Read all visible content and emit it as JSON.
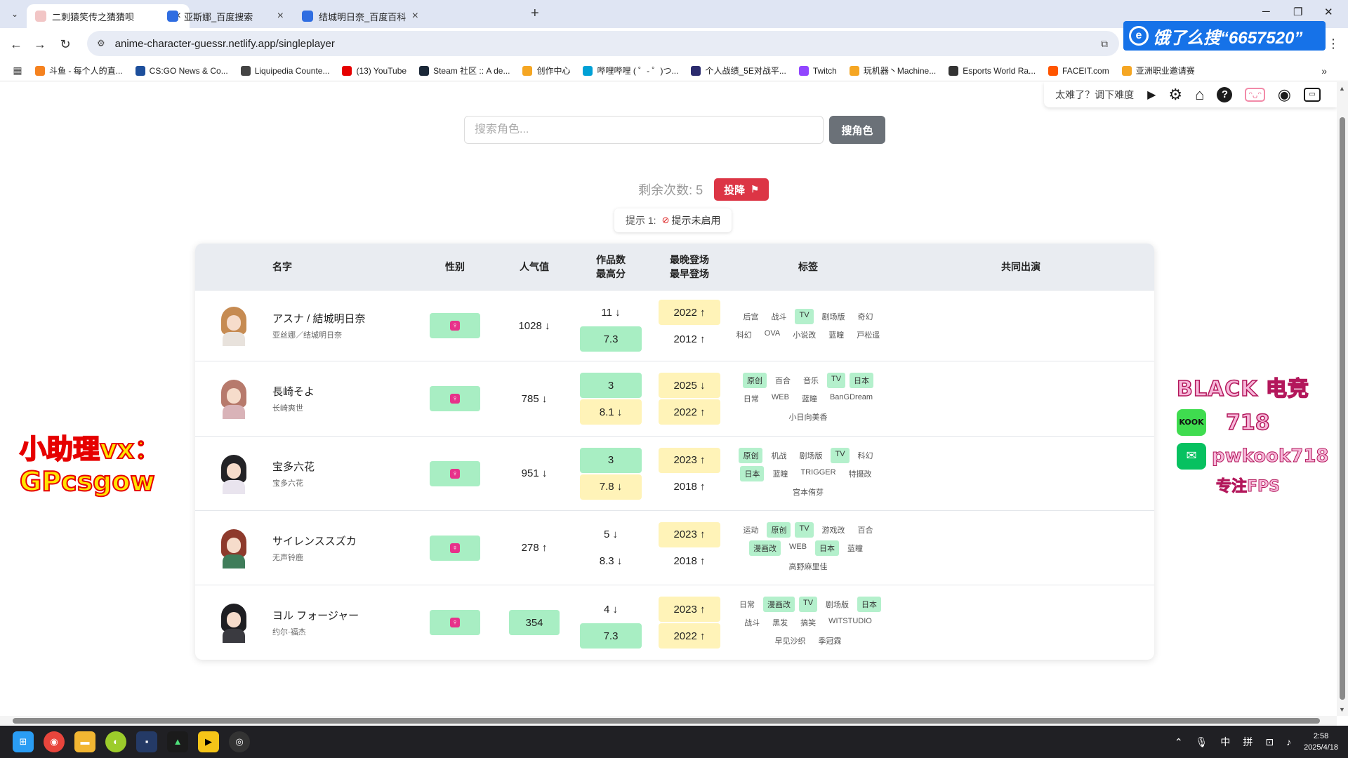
{
  "browser": {
    "tabs": [
      {
        "title": "二刺猿笑传之猜猜呗",
        "fav_color": "#f2c6c6",
        "active": true
      },
      {
        "title": "亚斯娜_百度搜索",
        "fav_color": "#2f6de1",
        "active": false
      },
      {
        "title": "结城明日奈_百度百科",
        "fav_color": "#2f6de1",
        "active": false
      }
    ],
    "url": "anime-character-guessr.netlify.app/singleplayer",
    "promo_text": "饿了么搜“6657520”",
    "bookmarks": [
      {
        "label": "斗鱼 - 每个人的直...",
        "color": "#f58220"
      },
      {
        "label": "CS:GO News & Co...",
        "color": "#1d4f9c"
      },
      {
        "label": "Liquipedia Counte...",
        "color": "#444444"
      },
      {
        "label": "(13) YouTube",
        "color": "#e60000"
      },
      {
        "label": "Steam 社区 :: A de...",
        "color": "#1b2838"
      },
      {
        "label": "创作中心",
        "color": "#f5a623"
      },
      {
        "label": "哔哩哔哩 ( ゜- ゜)つ...",
        "color": "#00a1d6"
      },
      {
        "label": "个人战绩_5E对战平...",
        "color": "#2b2b6e"
      },
      {
        "label": "Twitch",
        "color": "#9146ff"
      },
      {
        "label": "玩机器丶Machine...",
        "color": "#f5a623"
      },
      {
        "label": "Esports World Ra...",
        "color": "#333333"
      },
      {
        "label": "FACEIT.com",
        "color": "#ff5500"
      },
      {
        "label": "亚洲职业邀请赛",
        "color": "#f5a623"
      }
    ]
  },
  "controls": {
    "difficulty_text": "太难了？调下难度"
  },
  "search": {
    "placeholder": "搜索角色...",
    "button_label": "搜角色"
  },
  "status": {
    "remaining": "剩余次数: 5",
    "giveup_label": "投降",
    "hint_label": "提示 1:",
    "hint_value": "提示未启用"
  },
  "table": {
    "headers": {
      "name": "名字",
      "gender": "性别",
      "popularity": "人气值",
      "works_1": "作品数",
      "works_2": "最高分",
      "appear_1": "最晚登场",
      "appear_2": "最早登场",
      "tags": "标签",
      "co_star": "共同出演"
    },
    "rows": [
      {
        "name": "アスナ / 結城明日奈",
        "alt": "亚丝娜／结城明日奈",
        "avatar_hair": "#c68b52",
        "avatar_body": "#e8e2dc",
        "popularity": "1028 ↓",
        "pop_style": "",
        "works": "11 ↓",
        "works_style": "",
        "score": "7.3",
        "score_style": "green",
        "latest": "2022 ↑",
        "latest_style": "yellow",
        "earliest": "2012 ↑",
        "earliest_style": "",
        "tags": [
          {
            "t": "后宫",
            "hit": false
          },
          {
            "t": "战斗",
            "hit": false
          },
          {
            "t": "TV",
            "hit": true
          },
          {
            "t": "剧场版",
            "hit": false
          },
          {
            "t": "奇幻",
            "hit": false
          },
          {
            "t": "科幻",
            "hit": false
          },
          {
            "t": "OVA",
            "hit": false
          },
          {
            "t": "小说改",
            "hit": false
          },
          {
            "t": "蓝瞳",
            "hit": false
          },
          {
            "t": "戸松遥",
            "hit": false
          }
        ]
      },
      {
        "name": "長崎そよ",
        "alt": "长崎爽世",
        "avatar_hair": "#b77a6c",
        "avatar_body": "#d9b3b8",
        "popularity": "785 ↓",
        "pop_style": "",
        "works": "3",
        "works_style": "green",
        "score": "8.1 ↓",
        "score_style": "yellow",
        "latest": "2025 ↓",
        "latest_style": "yellow",
        "earliest": "2022 ↑",
        "earliest_style": "yellow",
        "tags": [
          {
            "t": "原创",
            "hit": true
          },
          {
            "t": "百合",
            "hit": false
          },
          {
            "t": "音乐",
            "hit": false
          },
          {
            "t": "TV",
            "hit": true
          },
          {
            "t": "日本",
            "hit": true
          },
          {
            "t": "日常",
            "hit": false
          },
          {
            "t": "WEB",
            "hit": false
          },
          {
            "t": "蓝瞳",
            "hit": false
          },
          {
            "t": "BanGDream",
            "hit": false
          },
          {
            "t": "小日向美香",
            "hit": false
          }
        ]
      },
      {
        "name": "宝多六花",
        "alt": "宝多六花",
        "avatar_hair": "#232326",
        "avatar_body": "#e9e4ee",
        "popularity": "951 ↓",
        "pop_style": "",
        "works": "3",
        "works_style": "green",
        "score": "7.8 ↓",
        "score_style": "yellow",
        "latest": "2023 ↑",
        "latest_style": "yellow",
        "earliest": "2018 ↑",
        "earliest_style": "",
        "tags": [
          {
            "t": "原创",
            "hit": true
          },
          {
            "t": "机战",
            "hit": false
          },
          {
            "t": "剧场版",
            "hit": false
          },
          {
            "t": "TV",
            "hit": true
          },
          {
            "t": "科幻",
            "hit": false
          },
          {
            "t": "日本",
            "hit": true
          },
          {
            "t": "蓝瞳",
            "hit": false
          },
          {
            "t": "TRIGGER",
            "hit": false
          },
          {
            "t": "特摄改",
            "hit": false
          },
          {
            "t": "宫本侑芽",
            "hit": false
          }
        ]
      },
      {
        "name": "サイレンススズカ",
        "alt": "无声铃鹿",
        "avatar_hair": "#8e3a2c",
        "avatar_body": "#3f7d5a",
        "popularity": "278 ↑",
        "pop_style": "",
        "works": "5 ↓",
        "works_style": "",
        "score": "8.3 ↓",
        "score_style": "",
        "latest": "2023 ↑",
        "latest_style": "yellow",
        "earliest": "2018 ↑",
        "earliest_style": "",
        "tags": [
          {
            "t": "运动",
            "hit": false
          },
          {
            "t": "原创",
            "hit": true
          },
          {
            "t": "TV",
            "hit": true
          },
          {
            "t": "游戏改",
            "hit": false
          },
          {
            "t": "百合",
            "hit": false
          },
          {
            "t": "漫画改",
            "hit": true
          },
          {
            "t": "WEB",
            "hit": false
          },
          {
            "t": "日本",
            "hit": true
          },
          {
            "t": "蓝瞳",
            "hit": false
          },
          {
            "t": "高野麻里佳",
            "hit": false
          }
        ]
      },
      {
        "name": "ヨル フォージャー",
        "alt": "约尔·福杰",
        "avatar_hair": "#1e1e22",
        "avatar_body": "#3a3a40",
        "popularity": "354",
        "pop_style": "green",
        "works": "4 ↓",
        "works_style": "",
        "score": "7.3",
        "score_style": "green",
        "latest": "2023 ↑",
        "latest_style": "yellow",
        "earliest": "2022 ↑",
        "earliest_style": "yellow",
        "tags": [
          {
            "t": "日常",
            "hit": false
          },
          {
            "t": "漫画改",
            "hit": true
          },
          {
            "t": "TV",
            "hit": true
          },
          {
            "t": "剧场版",
            "hit": false
          },
          {
            "t": "日本",
            "hit": true
          },
          {
            "t": "战斗",
            "hit": false
          },
          {
            "t": "黑发",
            "hit": false
          },
          {
            "t": "搞笑",
            "hit": false
          },
          {
            "t": "WITSTUDIO",
            "hit": false
          },
          {
            "t": "早见沙织",
            "hit": false
          },
          {
            "t": "季冠霖",
            "hit": false
          }
        ]
      }
    ]
  },
  "overlay": {
    "left_line1": "小助理vx：",
    "left_line2": "GPcsgow",
    "brand": "BLACK 电竞",
    "kook_icon": "KOOK",
    "kook_num": "718",
    "wx_id": "pwkook718",
    "tagline": "专注FPS"
  },
  "taskbar": {
    "input_cn": "中",
    "input_py": "拼",
    "time": "2:58",
    "date": "2025/4/18"
  }
}
